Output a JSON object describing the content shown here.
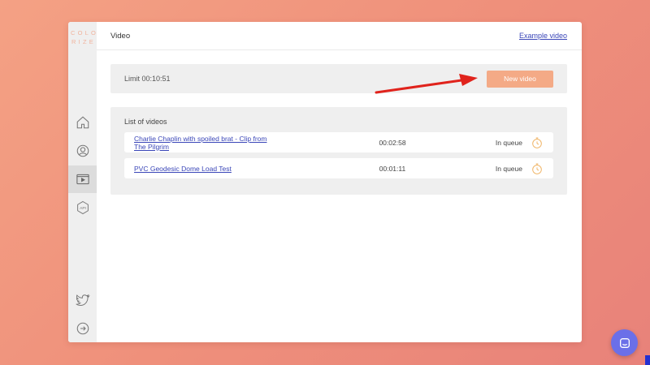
{
  "logo": {
    "line1": "COLO",
    "line2": "RIZE"
  },
  "header": {
    "title": "Video",
    "example_link": "Example video"
  },
  "limit": {
    "text": "Limit 00:10:51",
    "new_video_label": "New video"
  },
  "list": {
    "title": "List of videos",
    "videos": [
      {
        "name_line1": "Charlie Chaplin with spoiled brat - Clip from",
        "name_line2": "The Pilgrim",
        "duration": "00:02:58",
        "status": "In queue"
      },
      {
        "name_line1": "PVC Geodesic Dome Load Test",
        "name_line2": "",
        "duration": "00:01:11",
        "status": "In queue"
      }
    ]
  },
  "sidebar": {
    "items": [
      {
        "icon": "home-icon"
      },
      {
        "icon": "user-icon"
      },
      {
        "icon": "video-icon",
        "active": true
      },
      {
        "icon": "api-icon",
        "label": "API"
      }
    ],
    "bottom": [
      {
        "icon": "twitter-icon"
      },
      {
        "icon": "logout-icon"
      }
    ]
  },
  "colors": {
    "accent": "#f4aa86",
    "link": "#3a46b8",
    "arrow": "#e0231c",
    "chat": "#6b6fe8"
  }
}
